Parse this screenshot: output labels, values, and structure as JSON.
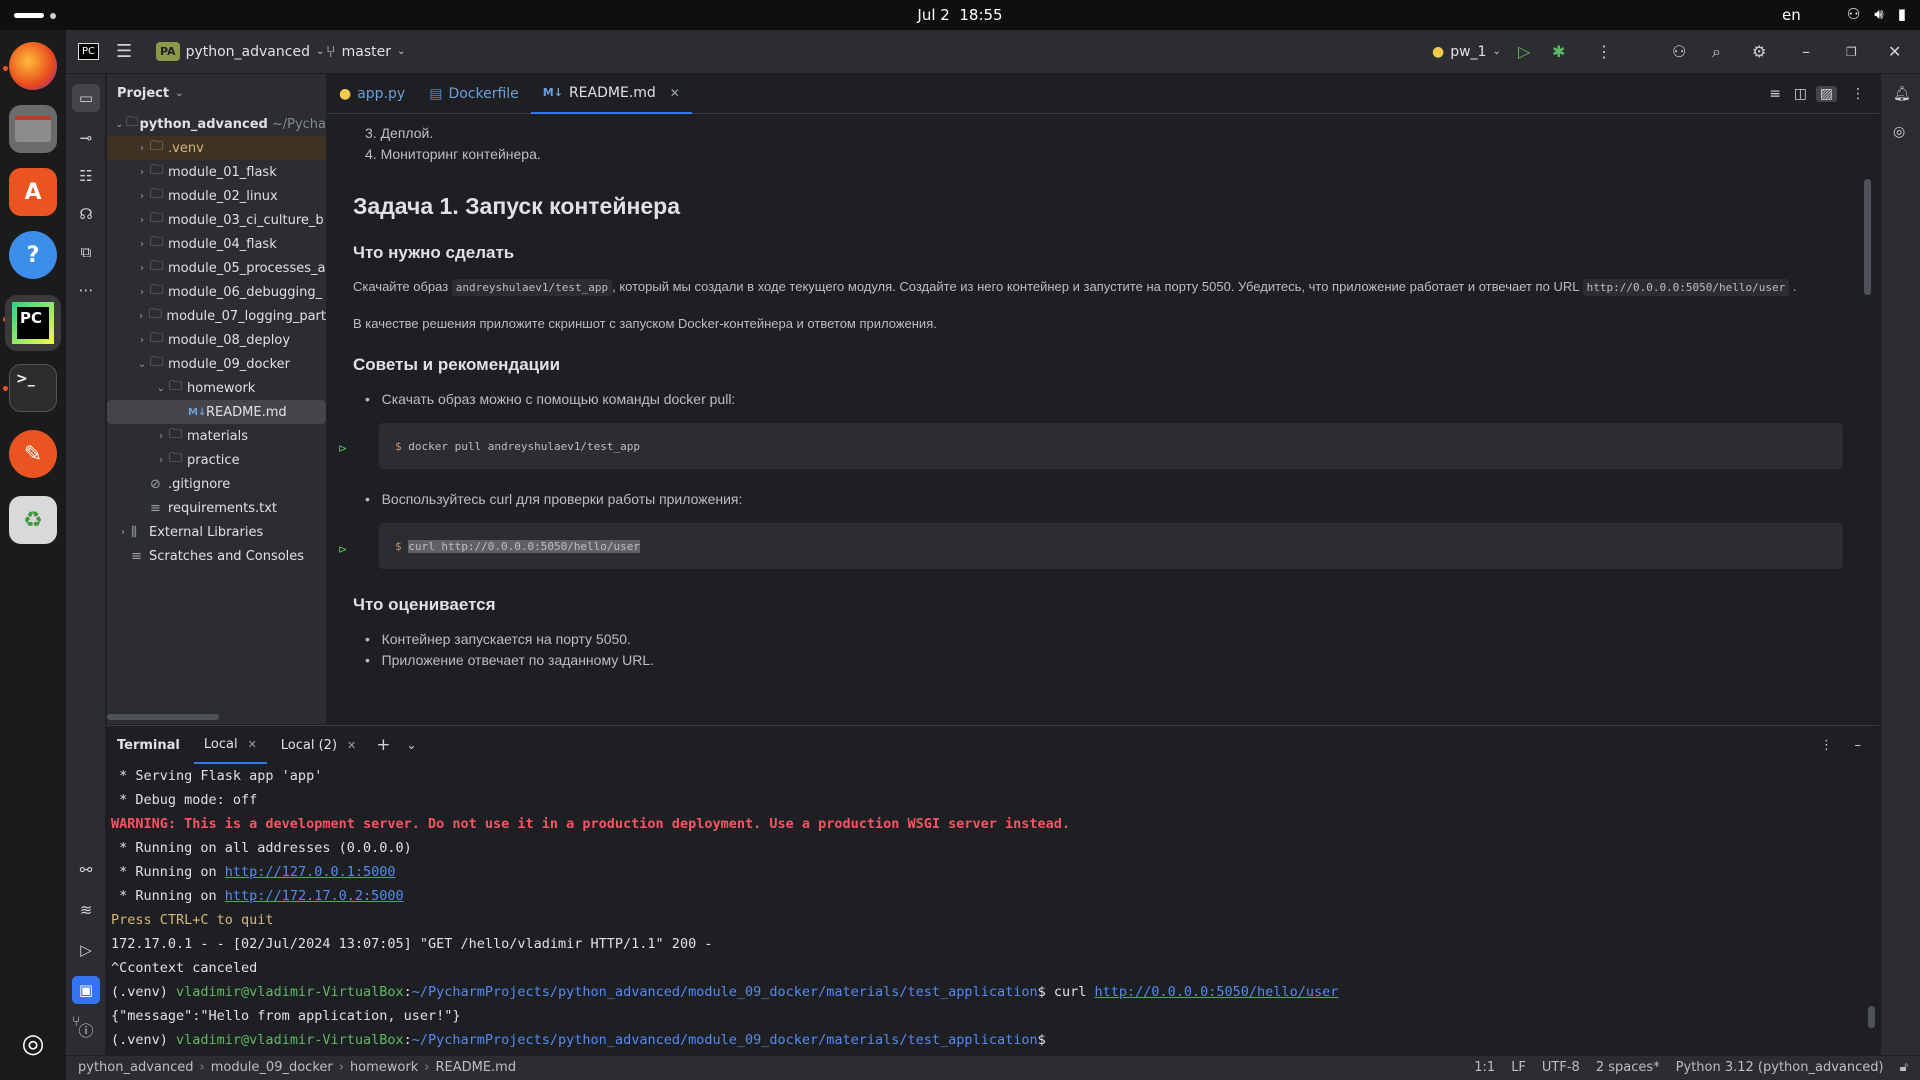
{
  "system": {
    "date": "Jul 2",
    "time": "18:55",
    "lang": "en"
  },
  "dock": [
    "firefox",
    "files",
    "app-center",
    "help",
    "pycharm",
    "terminal",
    "text-editor",
    "trash"
  ],
  "titlebar": {
    "project_badge": "PA",
    "project_name": "python_advanced",
    "branch": "master",
    "run_config": "pw_1"
  },
  "project_panel": {
    "title": "Project",
    "tree": [
      {
        "label": "python_advanced",
        "hint": "~/Pycha",
        "indent": 0,
        "type": "folder",
        "open": true
      },
      {
        "label": ".venv",
        "indent": 1,
        "type": "folder"
      },
      {
        "label": "module_01_flask",
        "indent": 1,
        "type": "folder"
      },
      {
        "label": "module_02_linux",
        "indent": 1,
        "type": "folder"
      },
      {
        "label": "module_03_ci_culture_b",
        "indent": 1,
        "type": "folder"
      },
      {
        "label": "module_04_flask",
        "indent": 1,
        "type": "folder"
      },
      {
        "label": "module_05_processes_a",
        "indent": 1,
        "type": "folder"
      },
      {
        "label": "module_06_debugging_",
        "indent": 1,
        "type": "folder"
      },
      {
        "label": "module_07_logging_part",
        "indent": 1,
        "type": "folder"
      },
      {
        "label": "module_08_deploy",
        "indent": 1,
        "type": "folder"
      },
      {
        "label": "module_09_docker",
        "indent": 1,
        "type": "folder",
        "open": true
      },
      {
        "label": "homework",
        "indent": 2,
        "type": "folder",
        "open": true
      },
      {
        "label": "README.md",
        "indent": 3,
        "type": "md"
      },
      {
        "label": "materials",
        "indent": 2,
        "type": "folder"
      },
      {
        "label": "practice",
        "indent": 2,
        "type": "folder"
      },
      {
        "label": ".gitignore",
        "indent": 1,
        "type": "ignore"
      },
      {
        "label": "requirements.txt",
        "indent": 1,
        "type": "txt"
      },
      {
        "label": "External Libraries",
        "indent": 0,
        "type": "lib"
      },
      {
        "label": "Scratches and Consoles",
        "indent": 0,
        "type": "scratch"
      }
    ]
  },
  "editor": {
    "tabs": [
      {
        "label": "app.py",
        "icon": "python-icon"
      },
      {
        "label": "Dockerfile",
        "icon": "docker-icon"
      },
      {
        "label": "README.md",
        "icon": "markdown-icon",
        "active": true
      }
    ],
    "md": {
      "list_top": [
        "3. Деплой.",
        "4. Мониторинг контейнера."
      ],
      "h1": "Задача 1. Запуск контейнера",
      "h2_what": "Что нужно сделать",
      "p1_a": "Скачайте образ",
      "p1_code1": "andreyshulaev1/test_app",
      "p1_b": ", который мы создали в ходе текущего модуля. Создайте из него контейнер и запустите на порту 5050. Убедитесь, что приложение работает и отвечает по URL",
      "p1_code2": "http://0.0.0.0:5050/hello/user",
      "p1_c": ".",
      "p2": "В качестве решения приложите скриншот с запуском Docker-контейнера и ответом приложения.",
      "h2_tips": "Советы и рекомендации",
      "tip1": "Скачать образ можно с помощью команды docker pull:",
      "code1_prompt": "$",
      "code1": "docker pull andreyshulaev1/test_app",
      "tip2": "Воспользуйтесь curl для проверки работы приложения:",
      "code2_prompt": "$",
      "code2": "curl http://0.0.0.0:5050/hello/user",
      "h2_eval": "Что оценивается",
      "eval1": "Контейнер запускается на порту 5050.",
      "eval2": "Приложение отвечает по заданному URL."
    }
  },
  "terminal": {
    "title": "Terminal",
    "tabs": [
      "Local",
      "Local (2)"
    ],
    "lines": {
      "l1": " * Serving Flask app 'app'",
      "l2": " * Debug mode: off",
      "l3": "WARNING: This is a development server. Do not use it in a production deployment. Use a production WSGI server instead.",
      "l4": " * Running on all addresses (0.0.0.0)",
      "l5a": " * Running on ",
      "l5b": "http://127.0.0.1:5000",
      "l6a": " * Running on ",
      "l6b": "http://172.17.0.2:5000",
      "l7": "Press CTRL+C to quit",
      "l8": "172.17.0.1 - - [02/Jul/2024 13:07:05] \"GET /hello/vladimir HTTP/1.1\" 200 -",
      "l9": "^Ccontext canceled",
      "venv": "(.venv) ",
      "user": "vladimir@vladimir-VirtualBox",
      "colon": ":",
      "path": "~/PycharmProjects/python_advanced/module_09_docker/materials/test_application",
      "dollar": "$ ",
      "cmd": "curl ",
      "cmd_url": "http://0.0.0.0:5050/hello/user",
      "l11": "{\"message\":\"Hello from application, user!\"}",
      "dollar2": "$"
    }
  },
  "statusbar": {
    "breadcrumb": [
      "python_advanced",
      "module_09_docker",
      "homework",
      "README.md"
    ],
    "pos": "1:1",
    "eol": "LF",
    "enc": "UTF-8",
    "indent": "2 spaces*",
    "interpreter": "Python 3.12 (python_advanced)"
  }
}
